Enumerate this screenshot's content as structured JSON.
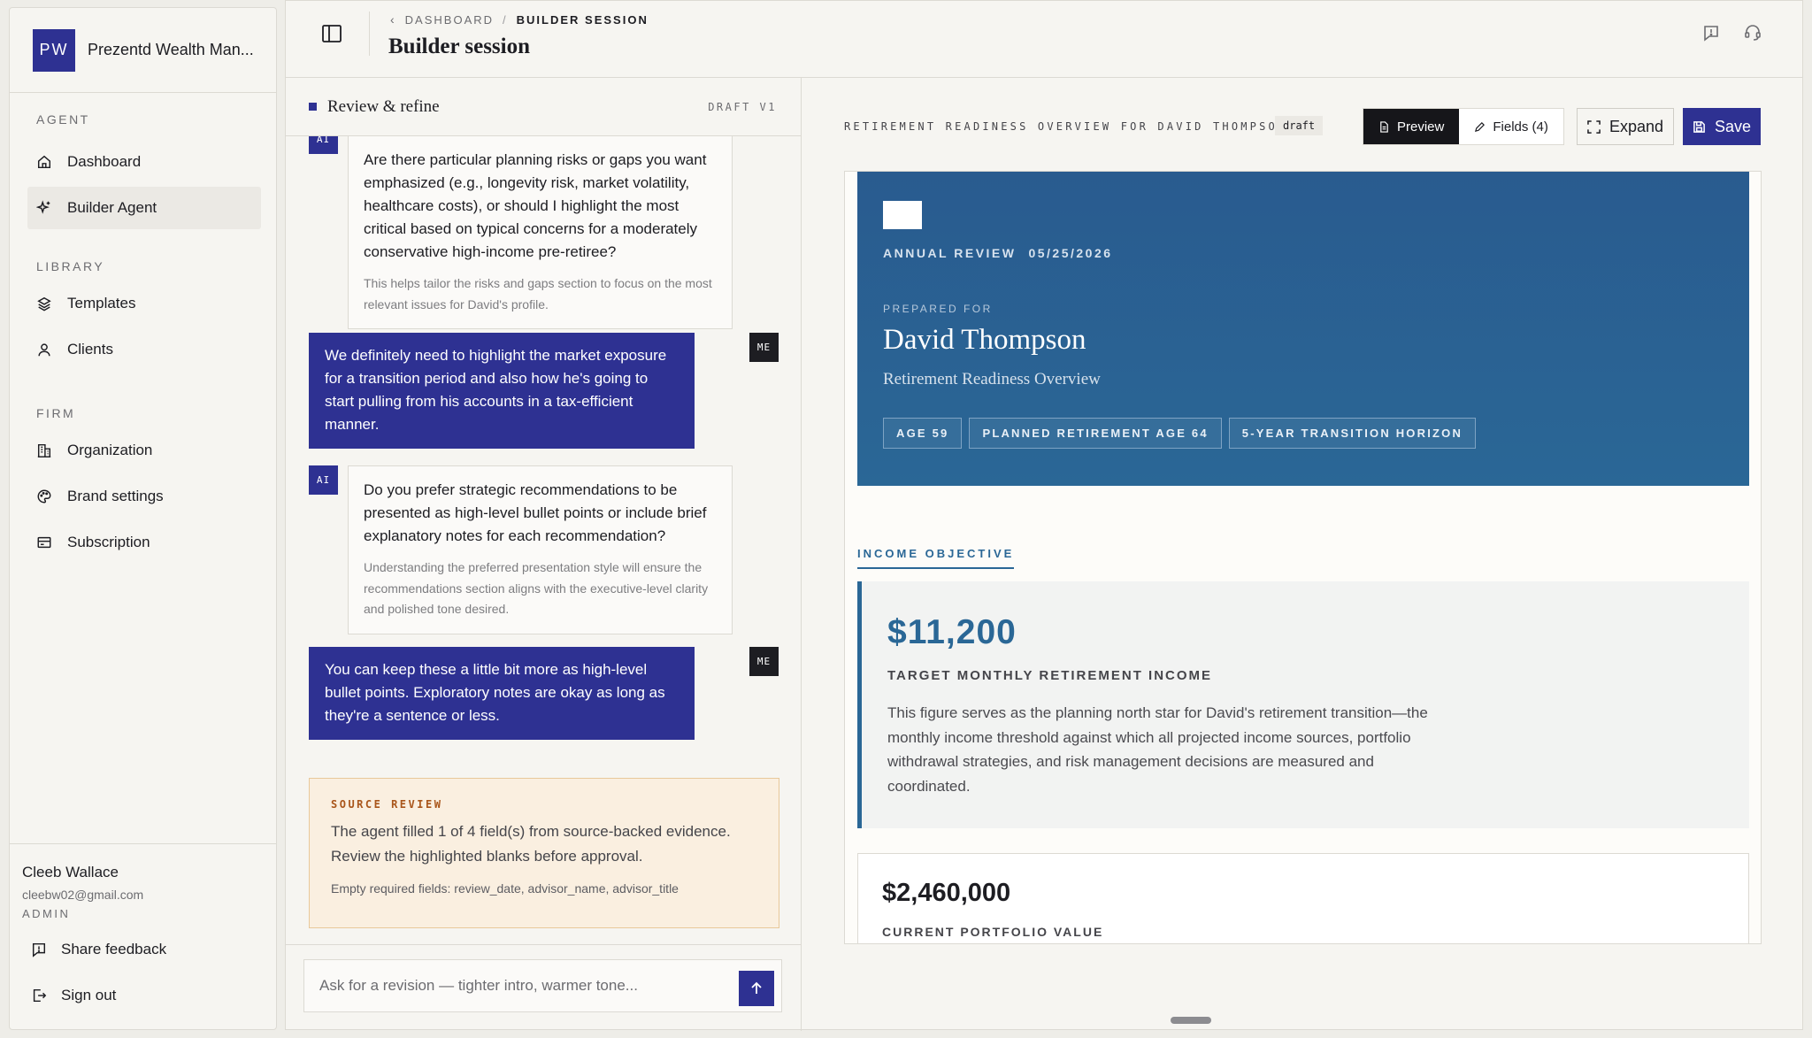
{
  "org": {
    "badge": "PW",
    "name": "Prezentd Wealth Man..."
  },
  "nav": {
    "agent_heading": "AGENT",
    "dashboard": "Dashboard",
    "builder_agent": "Builder Agent",
    "library_heading": "LIBRARY",
    "templates": "Templates",
    "clients": "Clients",
    "firm_heading": "FIRM",
    "organization": "Organization",
    "brand_settings": "Brand settings",
    "subscription": "Subscription"
  },
  "user": {
    "name": "Cleeb Wallace",
    "email": "cleebw02@gmail.com",
    "role": "ADMIN"
  },
  "footer": {
    "share_feedback": "Share feedback",
    "sign_out": "Sign out"
  },
  "header": {
    "breadcrumb_root": "DASHBOARD",
    "breadcrumb_sep": "/",
    "breadcrumb_current": "BUILDER SESSION",
    "title": "Builder session"
  },
  "chat": {
    "title": "Review & refine",
    "draft_tag": "DRAFT V1",
    "ai_tag": "AI",
    "me_tag": "ME",
    "messages": [
      {
        "role": "ai",
        "question": "Are there particular planning risks or gaps you want emphasized (e.g., longevity risk, market volatility, healthcare costs), or should I highlight the most critical based on typical concerns for a moderately conservative high-income pre-retiree?",
        "note": "This helps tailor the risks and gaps section to focus on the most relevant issues for David's profile."
      },
      {
        "role": "me",
        "text": "We definitely need to highlight the market exposure for a transition period and also how he's going to start pulling from his accounts in a tax-efficient manner."
      },
      {
        "role": "ai",
        "question": "Do you prefer strategic recommendations to be presented as high-level bullet points or include brief explanatory notes for each recommendation?",
        "note": "Understanding the preferred presentation style will ensure the recommendations section aligns with the executive-level clarity and polished tone desired."
      },
      {
        "role": "me",
        "text": "You can keep these a little bit more as high-level bullet points. Exploratory notes are okay as long as they're a sentence or less."
      }
    ],
    "source_review": {
      "label": "SOURCE REVIEW",
      "body": "The agent filled 1 of 4 field(s) from source-backed evidence. Review the highlighted blanks before approval.",
      "empty_fields": "Empty required fields: review_date, advisor_name, advisor_title"
    },
    "composer_placeholder": "Ask for a revision — tighter intro, warmer tone..."
  },
  "preview": {
    "doc_label": "RETIREMENT READINESS OVERVIEW FOR DAVID THOMPSON",
    "status": "draft",
    "preview_btn": "Preview",
    "fields_btn": "Fields (4)",
    "expand_btn": "Expand",
    "save_btn": "Save",
    "hero": {
      "review_label": "ANNUAL REVIEW",
      "review_date": "05/25/2026",
      "prepared_for": "PREPARED FOR",
      "client_name": "David Thompson",
      "subtitle": "Retirement Readiness Overview",
      "chips": [
        "AGE 59",
        "PLANNED RETIREMENT AGE 64",
        "5-YEAR TRANSITION HORIZON"
      ]
    },
    "income": {
      "section_label": "INCOME OBJECTIVE",
      "amount": "$11,200",
      "caption": "TARGET MONTHLY RETIREMENT INCOME",
      "body": "This figure serves as the planning north star for David's retirement transition—the monthly income threshold against which all projected income sources, portfolio withdrawal strategies, and risk management decisions are measured and coordinated."
    },
    "portfolio": {
      "amount": "$2,460,000",
      "caption": "CURRENT PORTFOLIO VALUE"
    }
  }
}
